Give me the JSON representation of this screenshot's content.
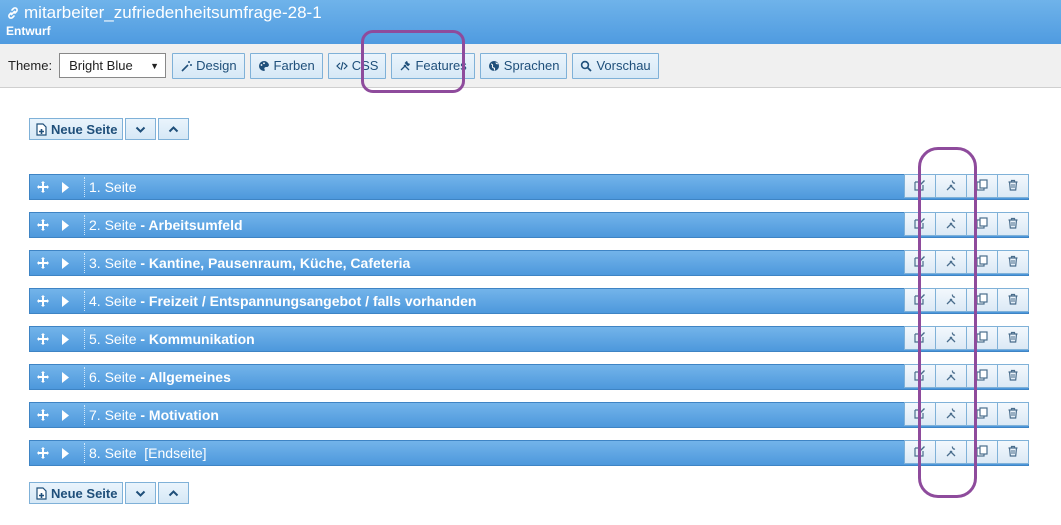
{
  "header": {
    "title": "mitarbeiter_zufriedenheitsumfrage-28-1",
    "subtitle": "Entwurf",
    "title_icon": "link-icon"
  },
  "toolbar": {
    "theme_label": "Theme:",
    "theme_value": "Bright Blue",
    "buttons": [
      {
        "label": "Design",
        "icon": "wand-icon"
      },
      {
        "label": "Farben",
        "icon": "palette-icon"
      },
      {
        "label": "CSS",
        "icon": "code-icon"
      },
      {
        "label": "Features",
        "icon": "tools-icon"
      },
      {
        "label": "Sprachen",
        "icon": "globe-icon"
      },
      {
        "label": "Vorschau",
        "icon": "search-icon"
      }
    ]
  },
  "page_controls": {
    "new_page_label": "Neue Seite"
  },
  "pages": [
    {
      "number": "1. Seite",
      "title": ""
    },
    {
      "number": "2. Seite",
      "title": "- Arbeitsumfeld"
    },
    {
      "number": "3. Seite",
      "title": "- Kantine, Pausenraum, Küche, Cafeteria"
    },
    {
      "number": "4. Seite",
      "title": "- Freizeit / Entspannungsangebot / falls vorhanden"
    },
    {
      "number": "5. Seite",
      "title": "- Kommunikation"
    },
    {
      "number": "6. Seite",
      "title": "- Allgemeines"
    },
    {
      "number": "7. Seite",
      "title": "- Motivation"
    },
    {
      "number": "8. Seite",
      "title": "[Endseite]",
      "plain": true
    }
  ],
  "colors": {
    "header": "#5ba6e5",
    "row": "#5aa2e2",
    "highlight": "#8e4b9c"
  }
}
